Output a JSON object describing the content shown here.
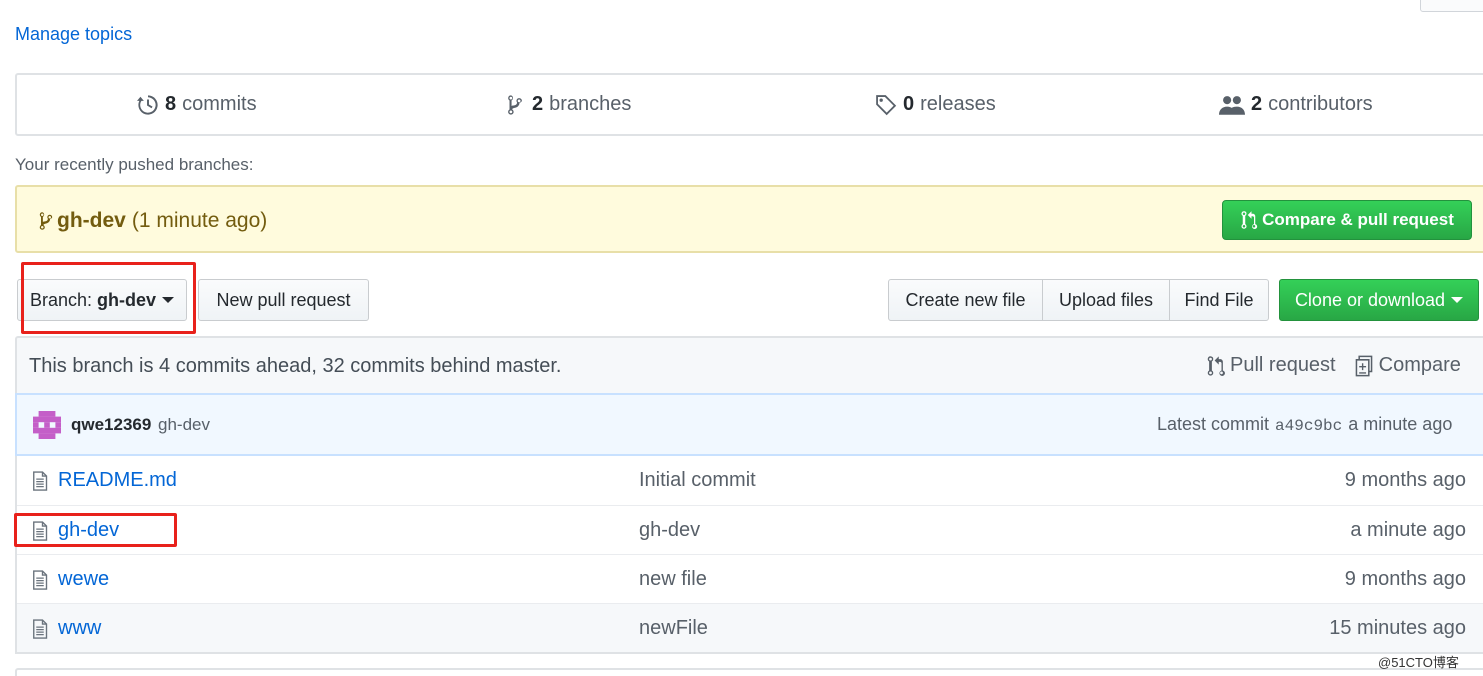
{
  "header": {
    "manage_topics": "Manage topics"
  },
  "summary": {
    "commits": {
      "count": "8",
      "label": "commits",
      "icon": "history-icon"
    },
    "branches": {
      "count": "2",
      "label": "branches",
      "icon": "git-branch-icon"
    },
    "releases": {
      "count": "0",
      "label": "releases",
      "icon": "tag-icon"
    },
    "contributors": {
      "count": "2",
      "label": "contributors",
      "icon": "people-icon"
    }
  },
  "recent": {
    "label": "Your recently pushed branches:",
    "branch": "gh-dev",
    "time": "(1 minute ago)",
    "compare_button": "Compare & pull request"
  },
  "toolbar": {
    "branch_prefix": "Branch:",
    "branch_name": "gh-dev",
    "new_pull_request": "New pull request",
    "create_new_file": "Create new file",
    "upload_files": "Upload files",
    "find_file": "Find File",
    "clone_or_download": "Clone or download"
  },
  "branch_info": {
    "message": "This branch is 4 commits ahead, 32 commits behind master.",
    "pull_request": "Pull request",
    "compare": "Compare"
  },
  "commit": {
    "author": "qwe12369",
    "message": "gh-dev",
    "latest_label": "Latest commit",
    "sha": "a49c9bc",
    "time": "a minute ago"
  },
  "files": [
    {
      "name": "README.md",
      "message": "Initial commit",
      "age": "9 months ago"
    },
    {
      "name": "gh-dev",
      "message": "gh-dev",
      "age": "a minute ago"
    },
    {
      "name": "wewe",
      "message": "new file",
      "age": "9 months ago"
    },
    {
      "name": "www",
      "message": "newFile",
      "age": "15 minutes ago"
    }
  ],
  "watermark": "@51CTO博客",
  "colors": {
    "link": "#0366d6",
    "green": "#28a745",
    "highlight": "#e8211b",
    "recent_bg": "#fffbdd"
  }
}
